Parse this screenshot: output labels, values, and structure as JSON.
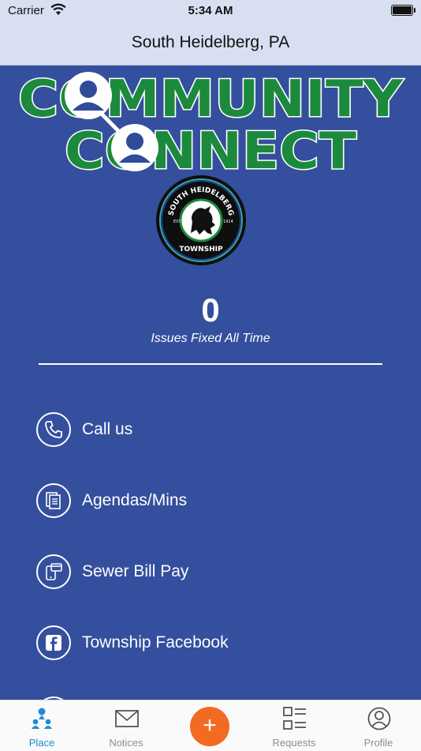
{
  "status": {
    "carrier": "Carrier",
    "time": "5:34 AM"
  },
  "navbar": {
    "title": "South Heidelberg, PA"
  },
  "brand": {
    "line1": "COMMUNITY",
    "line2": "CONNECT",
    "seal_top": "SOUTH HEIDELBERG",
    "seal_est": "EST.",
    "seal_year": "1914",
    "seal_bottom": "TOWNSHIP"
  },
  "stats": {
    "count": "0",
    "label": "Issues Fixed All Time"
  },
  "links": [
    {
      "label": "Call us",
      "icon": "phone-icon"
    },
    {
      "label": "Agendas/Mins",
      "icon": "documents-icon"
    },
    {
      "label": "Sewer Bill Pay",
      "icon": "mobile-payment-icon"
    },
    {
      "label": "Township Facebook",
      "icon": "facebook-icon"
    }
  ],
  "tabs": [
    {
      "label": "Place",
      "icon": "place-people-icon",
      "active": true
    },
    {
      "label": "Notices",
      "icon": "envelope-icon"
    },
    {
      "label": "",
      "icon": "plus-icon"
    },
    {
      "label": "Requests",
      "icon": "list-icon"
    },
    {
      "label": "Profile",
      "icon": "profile-icon"
    }
  ],
  "colors": {
    "background": "#344f9d",
    "header": "#d7dff0",
    "brand_green": "#1c8a3c",
    "accent_orange": "#f26b21",
    "tab_active": "#1e8bd8"
  }
}
